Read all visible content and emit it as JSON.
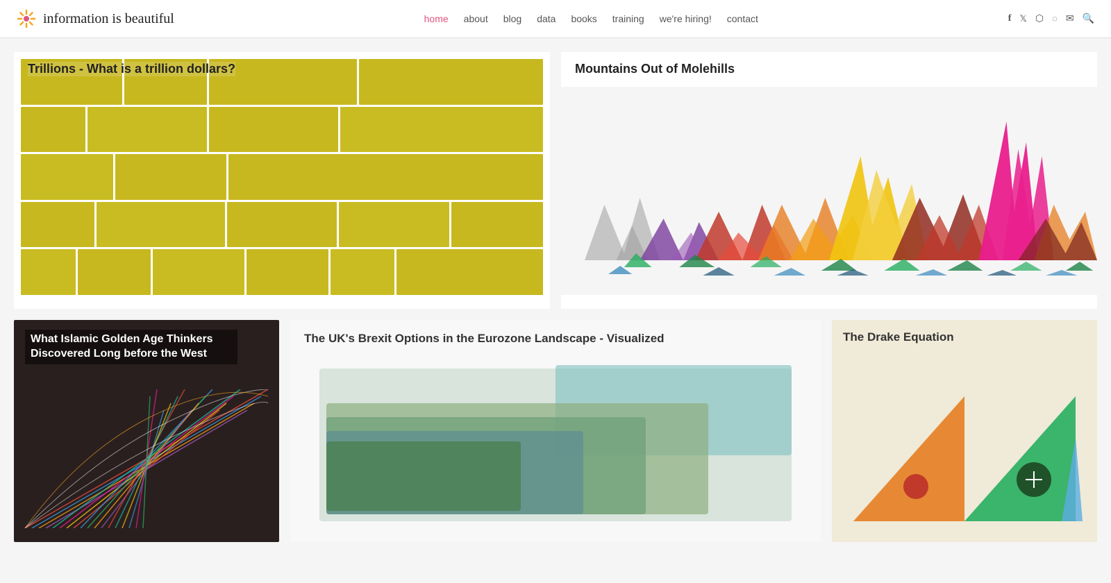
{
  "site": {
    "logo_text": "information is beautiful",
    "logo_icon": "🌐"
  },
  "nav": {
    "items": [
      {
        "label": "home",
        "href": "#",
        "active": true
      },
      {
        "label": "about",
        "href": "#",
        "active": false
      },
      {
        "label": "blog",
        "href": "#",
        "active": false
      },
      {
        "label": "data",
        "href": "#",
        "active": false
      },
      {
        "label": "books",
        "href": "#",
        "active": false
      },
      {
        "label": "training",
        "href": "#",
        "active": false
      },
      {
        "label": "we're hiring!",
        "href": "#",
        "active": false
      },
      {
        "label": "contact",
        "href": "#",
        "active": false
      }
    ]
  },
  "social": {
    "icons": [
      "f",
      "𝕏",
      "📷",
      "RSS",
      "✉",
      "🔍"
    ]
  },
  "cards": {
    "trillions": {
      "title": "Trillions - What is a trillion dollars?"
    },
    "mountains": {
      "title": "Mountains Out of Molehills"
    },
    "islamic": {
      "title": "What Islamic Golden Age Thinkers Discovered Long before the West"
    },
    "brexit": {
      "title": "The UK's Brexit Options in the Eurozone Landscape - Visualized"
    },
    "drake": {
      "title": "The Drake Equation"
    }
  }
}
